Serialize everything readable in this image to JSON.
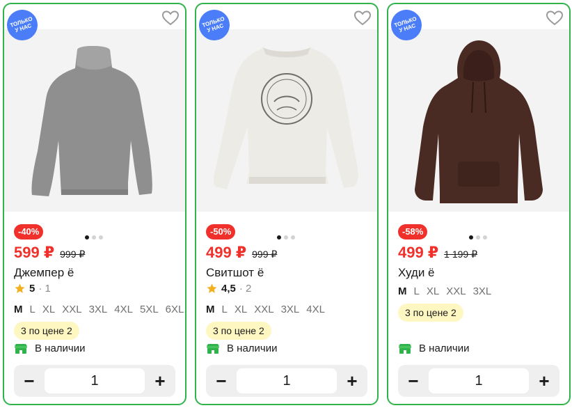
{
  "products": [
    {
      "badge": "Только у нас",
      "discount": "-40%",
      "price": "599 ₽",
      "old_price": "999 ₽",
      "title": "Джемпер ё",
      "rating": "5",
      "reviews": "· 1",
      "sizes": [
        "M",
        "L",
        "XL",
        "XXL",
        "3XL",
        "4XL",
        "5XL",
        "6XL..."
      ],
      "selected_size": "M",
      "promo": "3 по цене 2",
      "stock": "В наличии",
      "quantity": "1",
      "image": "grey-turtleneck-sweater"
    },
    {
      "badge": "Только у нас",
      "discount": "-50%",
      "price": "499 ₽",
      "old_price": "999 ₽",
      "title": "Свитшот ё",
      "rating": "4,5",
      "reviews": "· 2",
      "sizes": [
        "M",
        "L",
        "XL",
        "XXL",
        "3XL",
        "4XL"
      ],
      "selected_size": "M",
      "promo": "3 по цене 2",
      "stock": "В наличии",
      "quantity": "1",
      "image": "cream-sweatshirt-with-print"
    },
    {
      "badge": "Только у нас",
      "discount": "-58%",
      "price": "499 ₽",
      "old_price": "1 199 ₽",
      "title": "Худи ё",
      "sizes": [
        "M",
        "L",
        "XL",
        "XXL",
        "3XL"
      ],
      "selected_size": "M",
      "promo": "3 по цене 2",
      "stock": "В наличии",
      "quantity": "1",
      "image": "brown-hoodie"
    }
  ],
  "qty_controls": {
    "minus": "−",
    "plus": "+"
  },
  "colors": {
    "border": "#2fb34a",
    "price": "#f0302b",
    "badge": "#4a7df7",
    "promo_bg": "#fff7c2"
  },
  "icons": [
    "heart-outline-icon",
    "star-icon",
    "store-icon",
    "minus-icon",
    "plus-icon"
  ]
}
